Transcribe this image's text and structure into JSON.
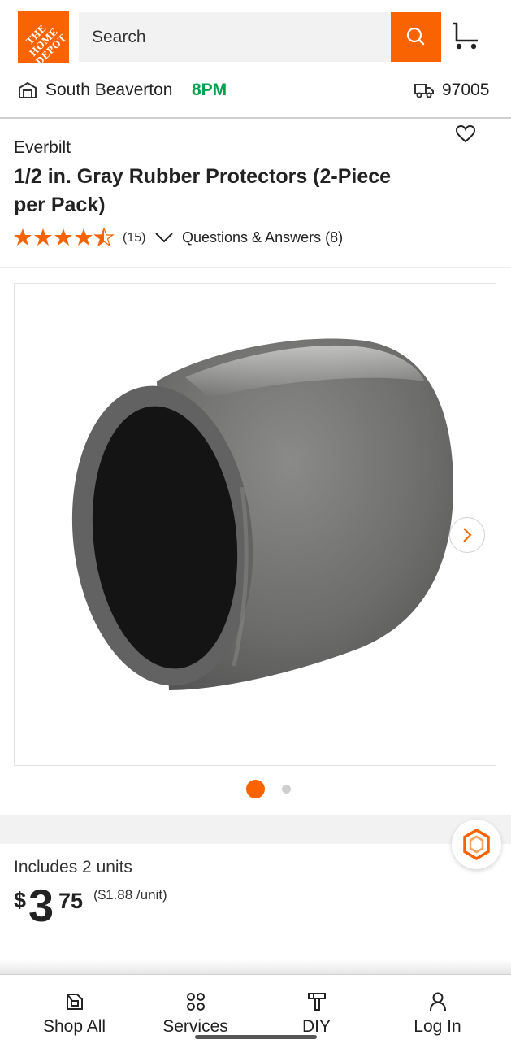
{
  "header": {
    "logo_text": "THE HOME DEPOT",
    "search_placeholder": "Search",
    "brand_color": "#f96302"
  },
  "store": {
    "name": "South Beaverton",
    "hours": "8PM",
    "zip": "97005",
    "hours_color": "#00a04d"
  },
  "product": {
    "brand": "Everbilt",
    "title": "1/2 in. Gray Rubber Protectors (2-Piece per Pack)",
    "rating": 4.5,
    "rating_max": 5,
    "review_count": "(15)",
    "qa_label": "Questions & Answers (8)",
    "image_index": 1,
    "image_count": 2
  },
  "pricing": {
    "includes": "Includes 2 units",
    "currency": "$",
    "dollars": "3",
    "cents": "75",
    "unit_price": "($1.88 /unit)"
  },
  "bottom_nav": {
    "items": [
      {
        "label": "Shop All",
        "icon": "shop-all-icon"
      },
      {
        "label": "Services",
        "icon": "services-icon"
      },
      {
        "label": "DIY",
        "icon": "hammer-icon"
      },
      {
        "label": "Log In",
        "icon": "user-icon"
      }
    ]
  }
}
